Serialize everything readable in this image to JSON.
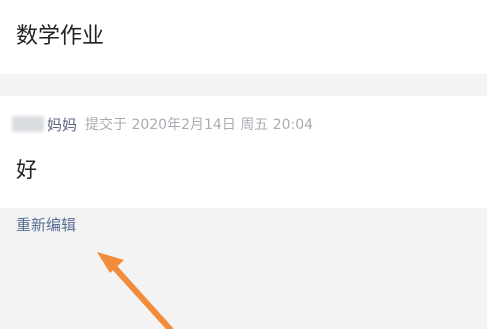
{
  "assignment": {
    "title": "数学作业"
  },
  "submission": {
    "submitter": "妈妈",
    "submitted_label": "提交于 2020年2月14日 周五 20:04",
    "content": "好"
  },
  "actions": {
    "reedit_label": "重新编辑"
  },
  "colors": {
    "arrow": "#f28c3a",
    "link": "#5b6f93"
  }
}
